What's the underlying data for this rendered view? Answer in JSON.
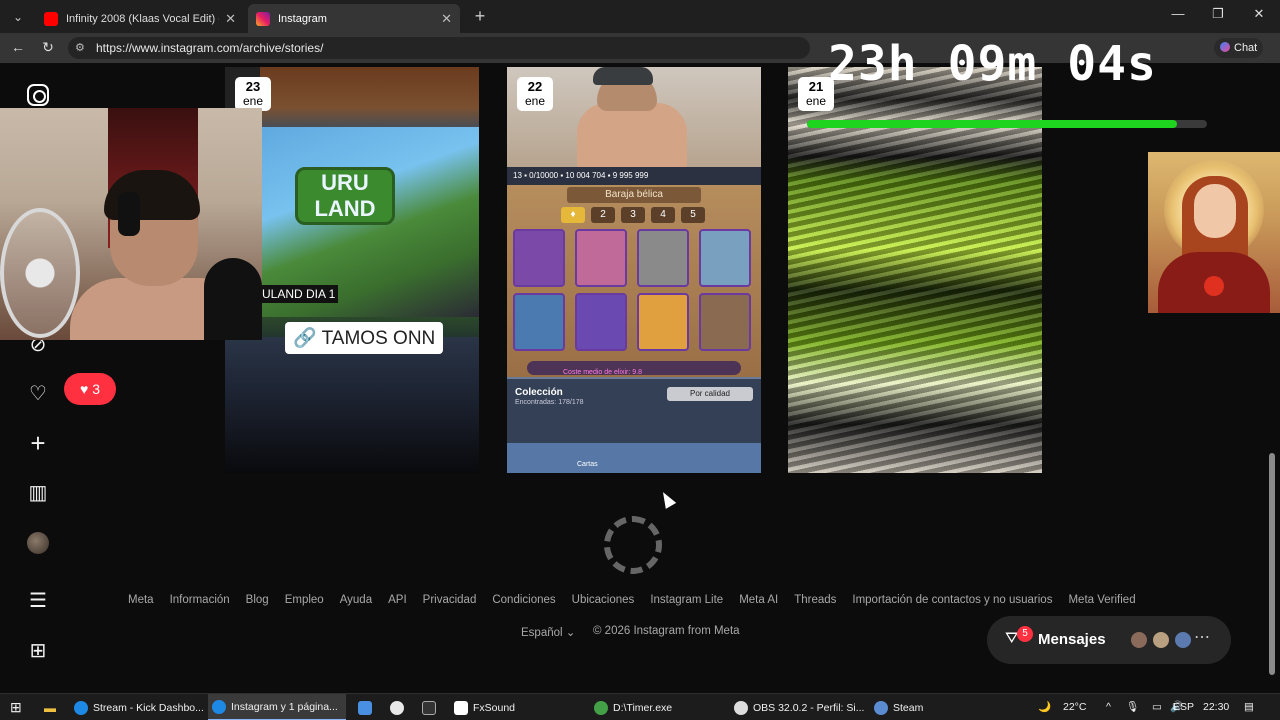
{
  "browser": {
    "tabs": [
      {
        "title": "Infinity 2008 (Klaas Vocal Edit) - Yo",
        "favicon": "youtube-icon",
        "active": false
      },
      {
        "title": "Instagram",
        "favicon": "instagram-icon",
        "active": true
      }
    ],
    "url": "https://www.instagram.com/archive/stories/",
    "chat_label": "Chat"
  },
  "stream_overlay": {
    "timer": "23h 09m 04s",
    "timer_progress": 0.925,
    "timer_bar_color": "#1fd41f"
  },
  "sidebar": {
    "notification_count": "3",
    "icons": [
      "instagram-icon",
      "explore-icon",
      "heart-icon",
      "create-icon",
      "insights-icon",
      "profile-avatar",
      "menu-icon",
      "more-apps-icon"
    ]
  },
  "stories": [
    {
      "day": "23",
      "month": "ene",
      "overlay_tag": "ULAND DIA 1",
      "link_text": "TAMOS ONN",
      "game_logo": "URU LAND"
    },
    {
      "day": "22",
      "month": "ene",
      "deck_title": "Baraja bélica",
      "deck_slots": [
        "2",
        "3",
        "4",
        "5"
      ],
      "elixir_text": "Coste medio de elixir: 9.8",
      "collection_title": "Colección",
      "collection_sub": "Encontradas: 178/178",
      "collection_button": "Por calidad",
      "nav_label": "Cartas"
    },
    {
      "day": "21",
      "month": "ene"
    }
  ],
  "footer": {
    "links": [
      "Meta",
      "Información",
      "Blog",
      "Empleo",
      "Ayuda",
      "API",
      "Privacidad",
      "Condiciones",
      "Ubicaciones",
      "Instagram Lite",
      "Meta AI",
      "Threads",
      "Importación de contactos y no usuarios",
      "Meta Verified"
    ],
    "language": "Español",
    "copyright": "© 2026 Instagram from Meta"
  },
  "messages": {
    "label": "Mensajes",
    "badge": "5"
  },
  "taskbar": {
    "items": [
      {
        "label": "Stream - Kick Dashbo...",
        "icon": "edge-icon",
        "color": "#1e88e5"
      },
      {
        "label": "Instagram y 1 página...",
        "icon": "edge-icon",
        "color": "#1e88e5"
      },
      {
        "label": "FxSound",
        "icon": "fxsound-icon",
        "color": "#ffffff"
      },
      {
        "label": "D:\\Timer.exe",
        "icon": "timer-icon",
        "color": "#43a047"
      },
      {
        "label": "OBS 32.0.2 - Perfil: Si...",
        "icon": "obs-icon",
        "color": "#dddddd"
      },
      {
        "label": "Steam",
        "icon": "steam-icon",
        "color": "#5b8bd0"
      }
    ],
    "weather": "22°C",
    "language": "ESP",
    "time": "22:30"
  }
}
